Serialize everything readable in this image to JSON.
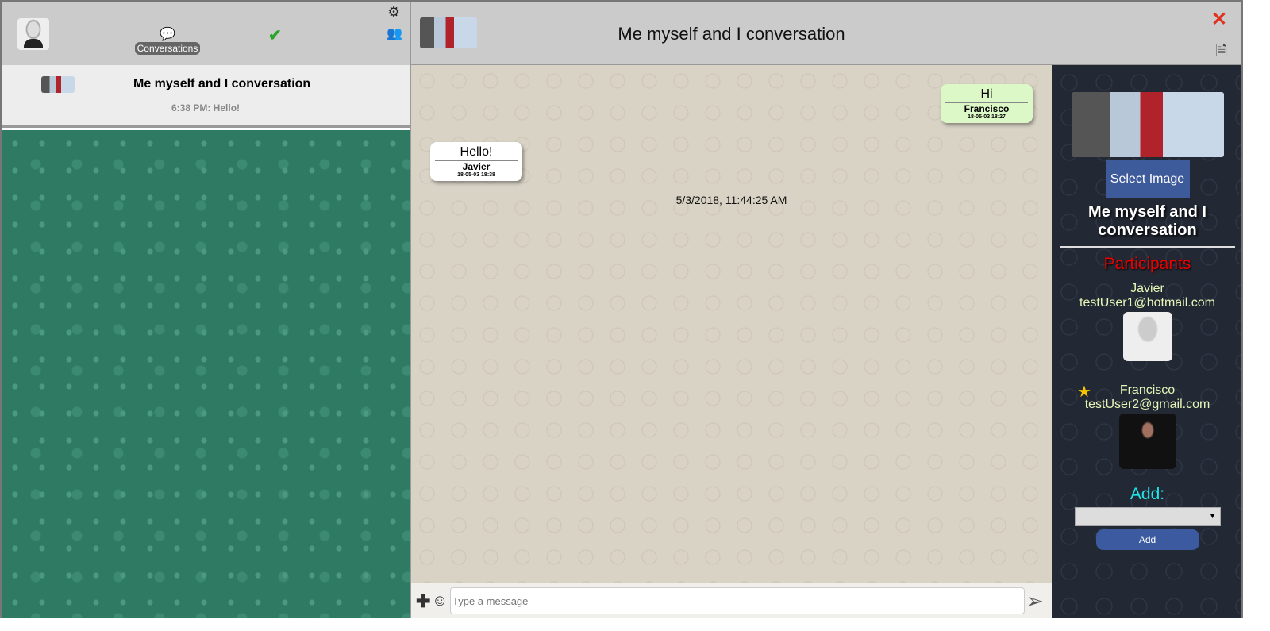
{
  "sidebar": {
    "conversations_label": "Conversations",
    "conversation": {
      "title": "Me myself and I conversation",
      "last_message": "6:38 PM: Hello!"
    }
  },
  "chat": {
    "title": "Me myself and I conversation",
    "messages": [
      {
        "text": "Hi",
        "author": "Francisco",
        "date": "18-05-03 18:27"
      },
      {
        "text": "Hello!",
        "author": "Javier",
        "date": "18-05-03 18:38"
      }
    ],
    "timestamp": "5/3/2018, 11:44:25 AM",
    "input_placeholder": "Type a message"
  },
  "details": {
    "select_image": "Select Image",
    "title": "Me myself and I conversation",
    "participants_label": "Participants",
    "participants": [
      {
        "name": "Javier",
        "email": "testUser1@hotmail.com"
      },
      {
        "name": "Francisco",
        "email": "testUser2@gmail.com",
        "admin": true
      }
    ],
    "add_label": "Add:",
    "add_button": "Add"
  }
}
